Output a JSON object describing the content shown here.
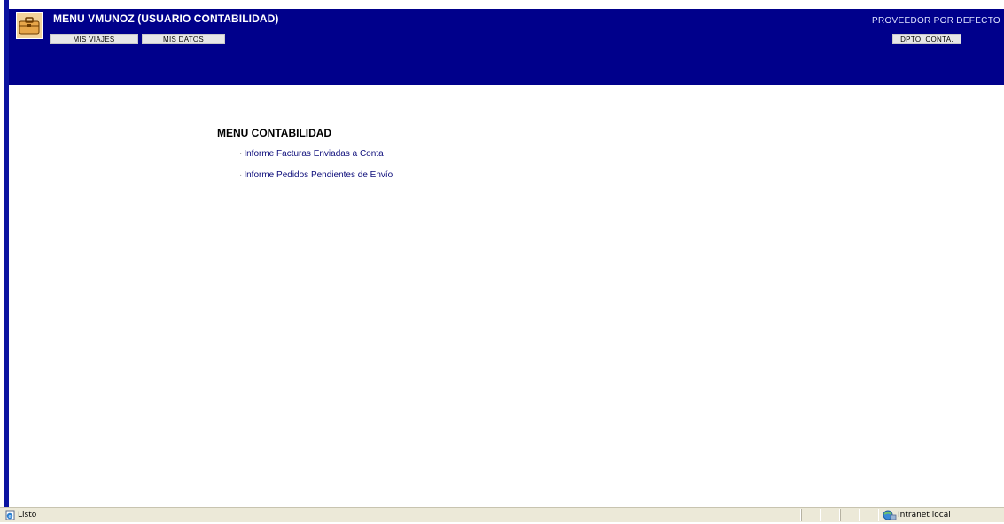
{
  "header": {
    "title": "MENU VMUNOZ (USUARIO CONTABILIDAD)",
    "provider": "PROVEEDOR POR DEFECTO",
    "nav_buttons": [
      {
        "label": "MIS VIAJES"
      },
      {
        "label": "MIS DATOS"
      }
    ],
    "department_button": "DPTO. CONTA.",
    "logo_icon": "suitcase-icon"
  },
  "menu": {
    "title": "MENU CONTABILIDAD",
    "bullet": "·",
    "links": [
      {
        "label": "Informe Facturas Enviadas a Conta"
      },
      {
        "label": "Informe Pedidos Pendientes de Envío"
      }
    ]
  },
  "status_bar": {
    "text": "Listo",
    "zone": "Intranet local",
    "page_icon": "ie-page-icon",
    "zone_icon": "intranet-globe-icon"
  },
  "colors": {
    "header_background": "#00008b",
    "link_color": "#0b0b7a",
    "button_background": "#e7e7e7",
    "status_bar_background": "#ece9d8"
  }
}
